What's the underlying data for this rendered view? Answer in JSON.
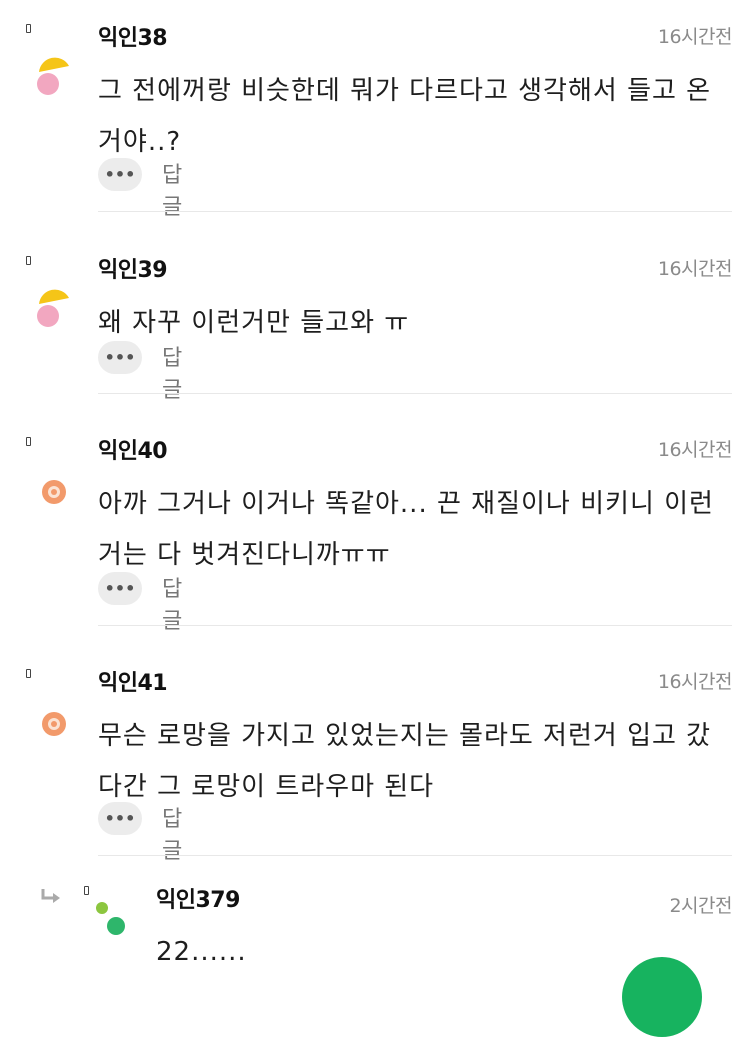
{
  "comments": [
    {
      "name": "익인38",
      "time": "16시간전",
      "text": "그 전에꺼랑 비슷한데 뭐가 다르다고 생각해서 들고 온거야..?",
      "more": "•••",
      "reply": "답글"
    },
    {
      "name": "익인39",
      "time": "16시간전",
      "text": "왜 자꾸 이런거만 들고와 ㅠ",
      "more": "•••",
      "reply": "답글"
    },
    {
      "name": "익인40",
      "time": "16시간전",
      "text": "아까 그거나 이거나 똑같아... 끈 재질이나 비키니 이런 거는 다 벗겨진다니까ㅠㅠ",
      "more": "•••",
      "reply": "답글"
    },
    {
      "name": "익인41",
      "time": "16시간전",
      "text": "무슨 로망을 가지고 있었는지는 몰라도 저런거 입고 갔다간 그 로망이 트라우마 된다",
      "more": "•••",
      "reply": "답글"
    }
  ],
  "nested_reply": {
    "name": "익인379",
    "time": "2시간전",
    "text": "22......"
  },
  "colors": {
    "avatar_yellow": "#f5c518",
    "avatar_pink": "#f2a7c0",
    "avatar_orange": "#f29a6b",
    "avatar_green_light": "#8cc63f",
    "avatar_green": "#2eb66b",
    "fab": "#17b35f"
  }
}
